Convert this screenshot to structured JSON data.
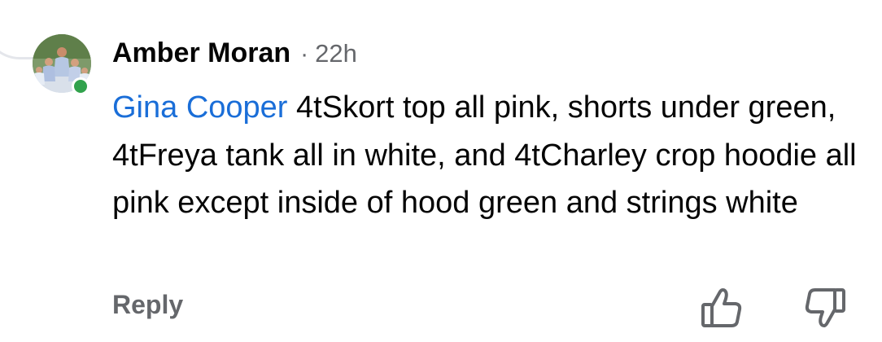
{
  "comment": {
    "author": "Amber Moran",
    "separator": "·",
    "time": "22h",
    "mention": "Gina Cooper",
    "text": " 4tSkort top all pink, shorts under green, 4tFreya tank all in white, and 4tCharley crop hoodie all pink except inside of hood green and strings white"
  },
  "actions": {
    "reply_label": "Reply",
    "like_icon": "thumbs-up-icon",
    "dislike_icon": "thumbs-down-icon"
  },
  "status": {
    "online": true,
    "online_color": "#31a24c"
  },
  "colors": {
    "mention": "#1a6ed8",
    "text": "#050505",
    "muted": "#65676b"
  }
}
